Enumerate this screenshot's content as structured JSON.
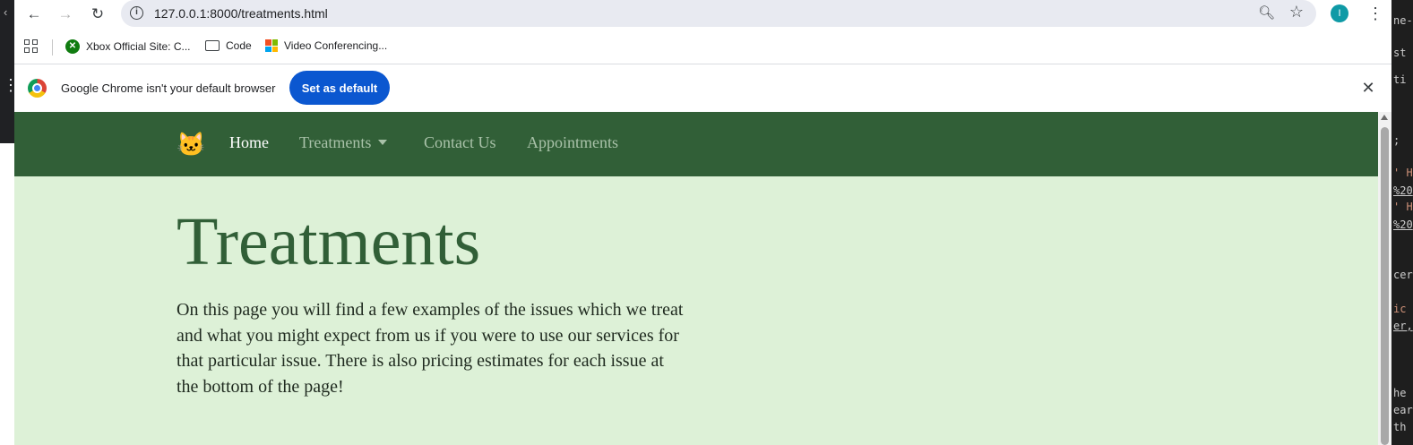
{
  "browser": {
    "url": "127.0.0.1:8000/treatments.html",
    "profile_initial": "I",
    "bookmarks": [
      {
        "label": "Xbox Official Site: C...",
        "icon": "xbox-icon"
      },
      {
        "label": "Code",
        "icon": "folder-icon"
      },
      {
        "label": "Video Conferencing...",
        "icon": "microsoft-icon"
      }
    ],
    "infobar": {
      "message": "Google Chrome isn't your default browser",
      "button": "Set as default"
    }
  },
  "site": {
    "brand_emoji": "🐱",
    "nav": [
      {
        "label": "Home",
        "active": true
      },
      {
        "label": "Treatments",
        "dropdown": true
      },
      {
        "label": "Contact Us"
      },
      {
        "label": "Appointments"
      }
    ],
    "title": "Treatments",
    "lead": "On this page you will find a few examples of the issues which we treat and what you might expect from us if you were to use our services for that particular issue. There is also pricing estimates for each issue at the bottom of the page!"
  },
  "colors": {
    "nav_bg": "#315f37",
    "page_bg": "#ddf1d7",
    "title": "#315f37",
    "chrome_button": "#0b57d0"
  }
}
